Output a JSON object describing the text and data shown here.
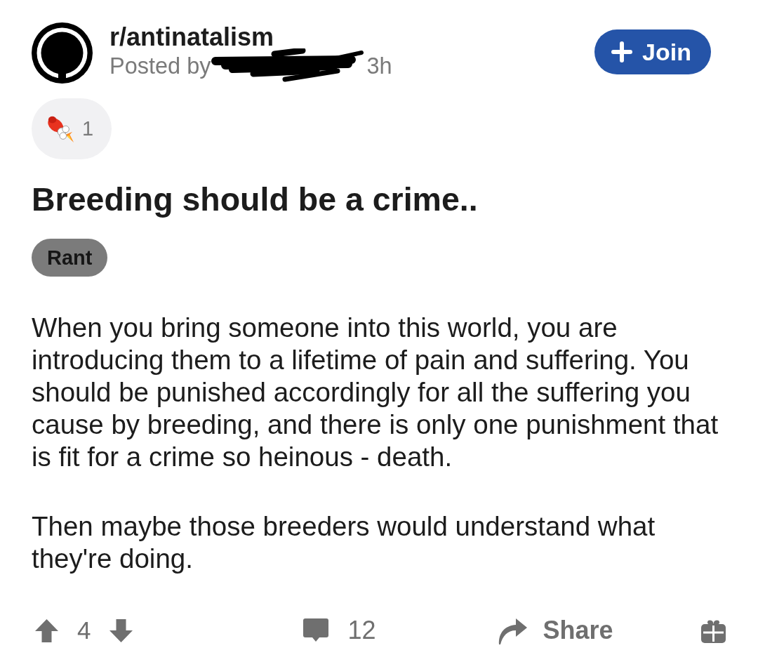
{
  "community": {
    "name": "r/antinatalism",
    "posted_by_label": "Posted by",
    "age": "3h"
  },
  "join_button": {
    "label": "Join"
  },
  "awards": [
    {
      "count": "1"
    }
  ],
  "post": {
    "title": "Breeding should be a crime..",
    "flair": "Rant",
    "paragraphs": [
      "When you bring someone into this world, you are introducing them to a lifetime of pain and suffering. You should be punished accordingly for all the suffering you cause by breeding, and there is only one punishment that is fit for a crime so heinous - death.",
      "Then maybe those breeders would understand what they're doing."
    ]
  },
  "actions": {
    "score": "4",
    "comments": "12",
    "share": "Share"
  }
}
